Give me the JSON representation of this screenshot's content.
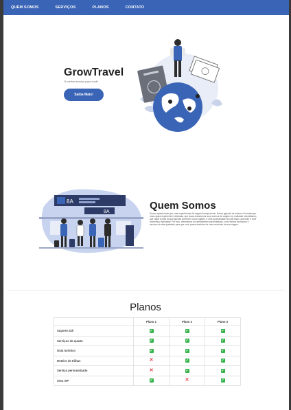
{
  "nav": {
    "items": [
      {
        "label": "QUEM SOMOS"
      },
      {
        "label": "SERVIÇOS"
      },
      {
        "label": "PLANOS"
      },
      {
        "label": "CONTATO"
      }
    ]
  },
  "hero": {
    "title": "GrowTravel",
    "subtitle": "O melhor serviço para você!",
    "button_label": "Saiba Mais!"
  },
  "about": {
    "title": "Quem Somos",
    "text": "Somos apaixonados por criar experiências de viagem inesquecíveis. Nossa agência de turismo é formada por uma equipe experiente e dedicada, que busca transformar seus sonhos de viagem em realidade. Acreditamos que viajar é mais do que apenas conhecer novos lugares, é uma oportunidade de criar laços, aprender e viver momentos marcantes. Por isso, oferecemos um atendimento personalizado, com roteiros exclusivos e serviços de alta qualidade para que você possa desfrutar de cada momento da sua viagem.",
    "board_code_1": "8A",
    "board_code_2": "8A"
  },
  "plans": {
    "title": "Planos",
    "columns": [
      "Plano 1",
      "Plano 2",
      "Plano 3"
    ],
    "rows": [
      {
        "feature": "Suporte 24h",
        "values": [
          true,
          true,
          true
        ]
      },
      {
        "feature": "Serviços de quarto",
        "values": [
          true,
          true,
          true
        ]
      },
      {
        "feature": "Guia turístico",
        "values": [
          true,
          true,
          true
        ]
      },
      {
        "feature": "Roteiro de trilhas",
        "values": [
          false,
          true,
          true
        ]
      },
      {
        "feature": "Serviço personalizado",
        "values": [
          false,
          true,
          true
        ]
      },
      {
        "feature": "Área VIP",
        "values": [
          true,
          false,
          true
        ]
      }
    ]
  },
  "colors": {
    "accent": "#3a64b6",
    "check": "#35b34a",
    "cross": "#e0333f"
  },
  "icons": {
    "check": "check-icon",
    "cross": "cross-icon"
  }
}
